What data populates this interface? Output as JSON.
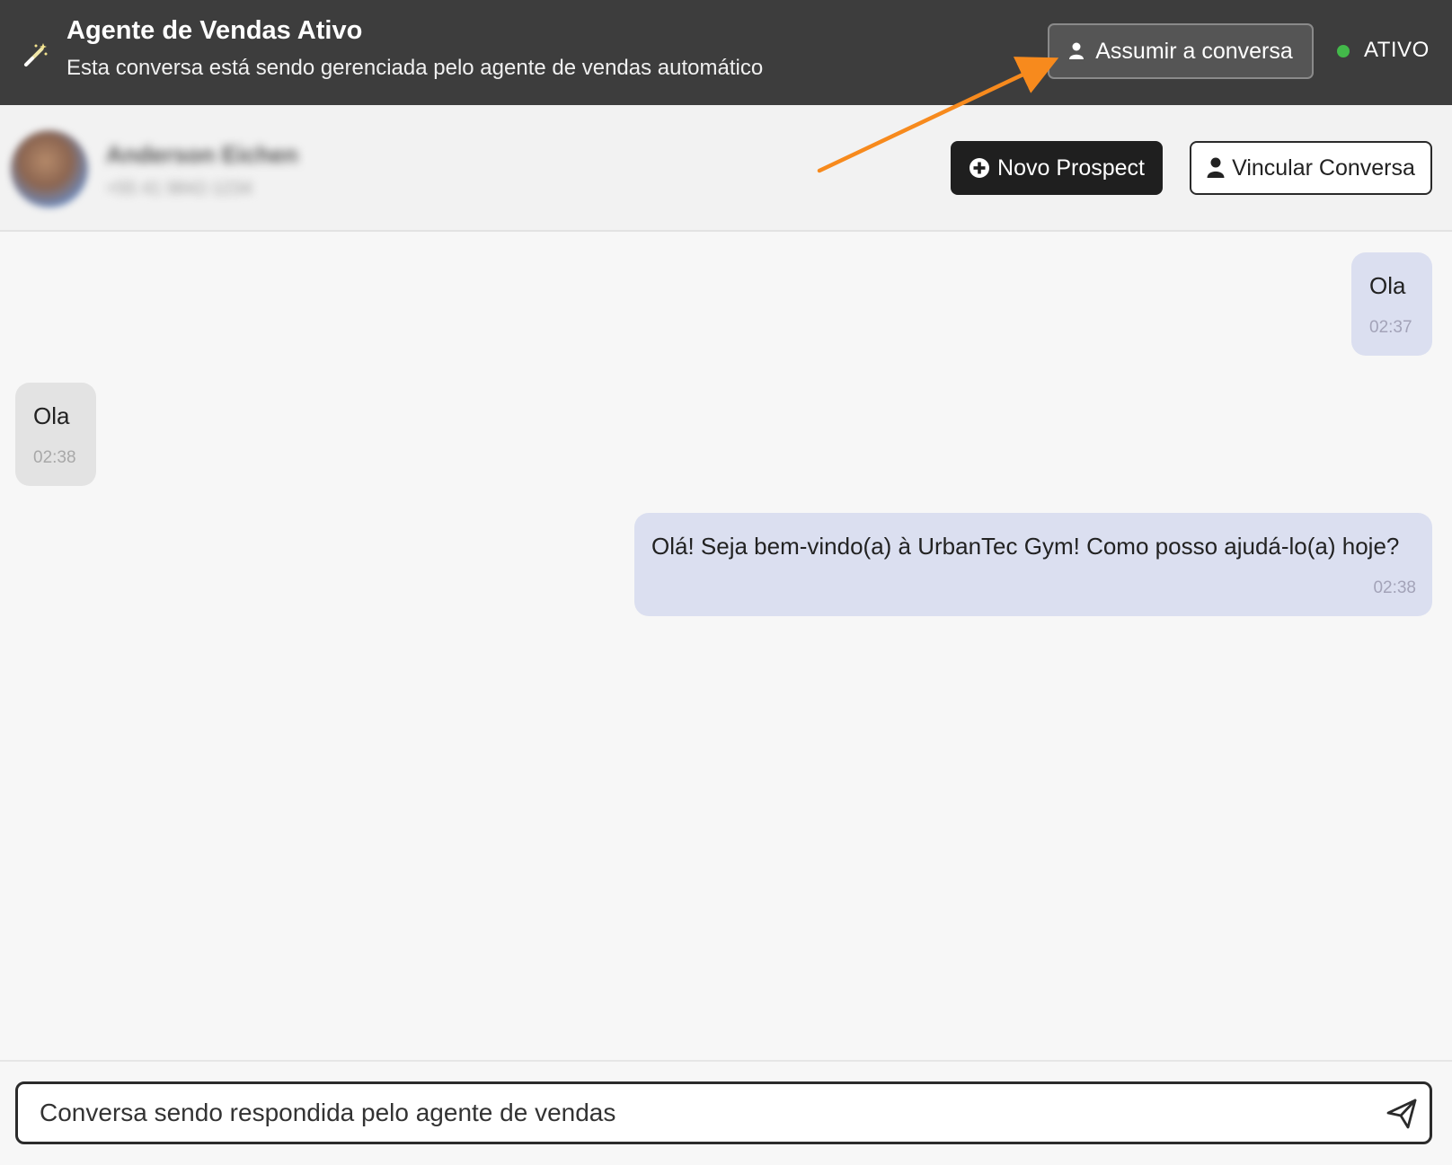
{
  "agent_banner": {
    "title": "Agente de Vendas Ativo",
    "subtitle": "Esta conversa está sendo gerenciada pelo agente de vendas automático",
    "takeover_label": "Assumir a conversa",
    "status_label": "ATIVO",
    "status_color": "#43b94a",
    "icon": "magic-wand-icon"
  },
  "contact": {
    "name": "Anderson Eichen",
    "phone": "+55 41 9842-1234"
  },
  "actions": {
    "new_prospect_label": "Novo Prospect",
    "link_conversation_label": "Vincular Conversa"
  },
  "messages": [
    {
      "direction": "outgoing",
      "text": "Ola",
      "time": "02:37"
    },
    {
      "direction": "incoming",
      "text": "Ola",
      "time": "02:38"
    },
    {
      "direction": "outgoing",
      "text": "Olá! Seja bem-vindo(a) à UrbanTec Gym! Como posso ajudá-lo(a) hoje?",
      "time": "02:38"
    }
  ],
  "composer": {
    "placeholder": "Conversa sendo respondida pelo agente de vendas",
    "send_icon": "send-icon"
  },
  "colors": {
    "banner_bg": "#3d3d3d",
    "annotation_arrow": "#f78a1d",
    "outgoing_bubble": "#dbdff0",
    "incoming_bubble": "#e3e3e3"
  }
}
